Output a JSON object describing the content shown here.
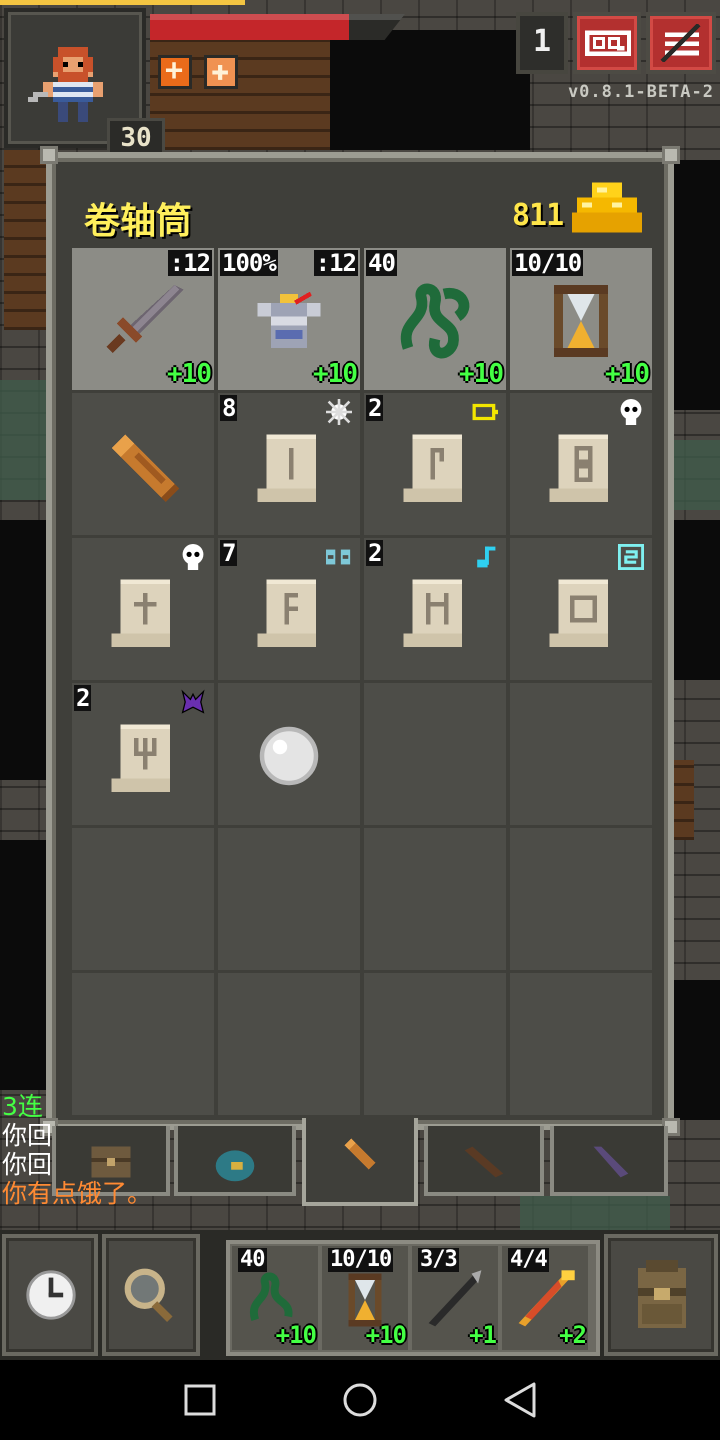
{
  "status": {
    "level": "30",
    "depth": "1",
    "version": "v0.8.1-BETA-2",
    "hp_fraction": 0.78,
    "exp_fraction": 0.34,
    "buffs": [
      {
        "icon": "plus-buff-icon",
        "symbol": "+",
        "color": "#ea6b1a"
      },
      {
        "icon": "blessed-buff-icon",
        "symbol": "✚",
        "color": "#f09252"
      }
    ]
  },
  "bag": {
    "title": "卷轴筒",
    "gold": "811",
    "equipped": [
      {
        "icon": "sword-icon",
        "top_left": "",
        "top_right": ":12",
        "bottom_right": "+10"
      },
      {
        "icon": "armor-icon",
        "top_left": "100%",
        "top_right": ":12",
        "bottom_right": "+10"
      },
      {
        "icon": "chain-artifact-icon",
        "top_left": "40",
        "top_right": "",
        "bottom_right": "+10"
      },
      {
        "icon": "hourglass-icon",
        "top_left": "10/10",
        "top_right": "",
        "bottom_right": "+10"
      }
    ],
    "items": [
      {
        "icon": "scroll-holder-icon",
        "count": "",
        "rune": ""
      },
      {
        "icon": "scroll-icon",
        "count": "8",
        "rune": "sparkle-rune-icon",
        "rune_color": "#ffffff"
      },
      {
        "icon": "scroll-icon",
        "count": "2",
        "rune": "battery-rune-icon",
        "rune_color": "#f3e600"
      },
      {
        "icon": "scroll-icon",
        "count": "",
        "rune": "skull-rune-icon",
        "rune_color": "#ffffff"
      },
      {
        "icon": "scroll-icon",
        "count": "",
        "rune": "skull-rune-icon",
        "rune_color": "#ffffff"
      },
      {
        "icon": "scroll-icon",
        "count": "7",
        "rune": "teleport-rune-icon",
        "rune_color": "#7ec8d8"
      },
      {
        "icon": "scroll-icon",
        "count": "2",
        "rune": "music-note-rune-icon",
        "rune_color": "#2fd0f0"
      },
      {
        "icon": "scroll-icon",
        "count": "",
        "rune": "map-rune-icon",
        "rune_color": "#7ff0f0"
      },
      {
        "icon": "scroll-icon",
        "count": "2",
        "rune": "demon-rune-icon",
        "rune_color": "#6a2fb0"
      },
      {
        "icon": "stone-icon",
        "count": "",
        "rune": ""
      }
    ],
    "tabs": [
      {
        "icon": "backpack-tab-icon",
        "active": false
      },
      {
        "icon": "pouch-tab-icon",
        "active": false
      },
      {
        "icon": "scroll-holder-tab-icon",
        "active": true
      },
      {
        "icon": "wand-holster-tab-icon",
        "active": false
      },
      {
        "icon": "potion-bandolier-tab-icon",
        "active": false
      }
    ]
  },
  "log": [
    {
      "text": "3连",
      "color": "#44ff44"
    },
    {
      "text": "你回",
      "color": "#ffffff"
    },
    {
      "text": "你回",
      "color": "#ffffff"
    },
    {
      "text": "你有点饿了。",
      "color": "#ff8a33"
    }
  ],
  "toolbar": {
    "wait": "clock-icon",
    "search": "magnifier-icon",
    "inventory": "backpack-icon",
    "quickslots": [
      {
        "icon": "chain-artifact-icon",
        "top": "40",
        "bottom": "+10"
      },
      {
        "icon": "hourglass-icon",
        "top": "10/10",
        "bottom": "+10"
      },
      {
        "icon": "dark-wand-icon",
        "top": "3/3",
        "bottom": "+1"
      },
      {
        "icon": "fire-wand-icon",
        "top": "4/4",
        "bottom": "+2"
      }
    ]
  },
  "colors": {
    "hp": "#c4262a",
    "exp": "#f4c542",
    "gold": "#ffe64a",
    "upgrade": "#44ff44",
    "title": "#ffef5c"
  }
}
